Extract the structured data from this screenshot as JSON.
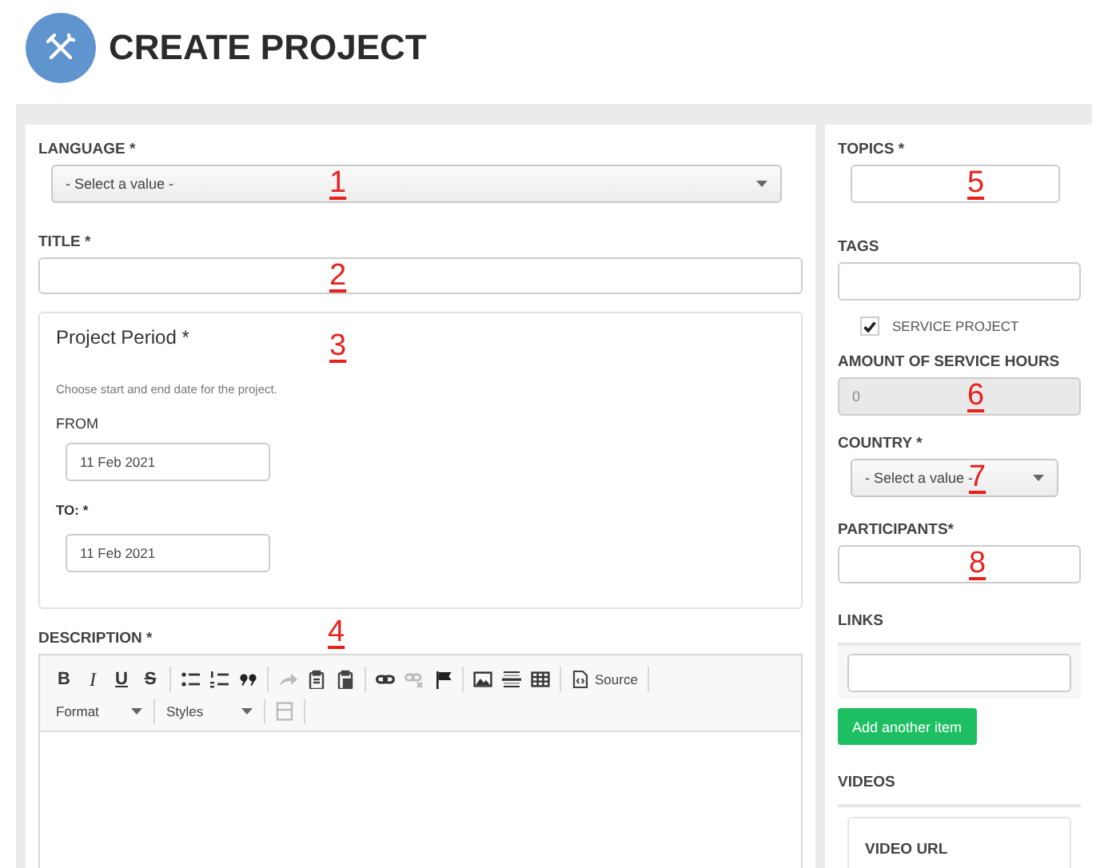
{
  "header": {
    "title": "CREATE PROJECT"
  },
  "main": {
    "language": {
      "label": "LANGUAGE *",
      "value": "- Select a value -",
      "annotation": "1"
    },
    "title": {
      "label": "TITLE *",
      "annotation": "2"
    },
    "period": {
      "heading": "Project Period *",
      "annotation": "3",
      "hint": "Choose start and end date for the project.",
      "from": {
        "label": "FROM",
        "value": "11 Feb 2021"
      },
      "to": {
        "label": "TO: *",
        "value": "11 Feb 2021"
      }
    },
    "description": {
      "label": "DESCRIPTION *",
      "annotation": "4",
      "toolbar": [
        [
          [
            {
              "kind": "bold",
              "label": "B",
              "disabled": false
            },
            {
              "kind": "italic",
              "label": "I",
              "disabled": false
            },
            {
              "kind": "underline",
              "label": "U",
              "disabled": false
            },
            {
              "kind": "strike",
              "label": "S",
              "disabled": false
            }
          ],
          [
            {
              "kind": "bullets",
              "disabled": false
            },
            {
              "kind": "numbers",
              "disabled": false
            },
            {
              "kind": "quote",
              "disabled": false
            }
          ],
          [
            {
              "kind": "redo",
              "disabled": true
            },
            {
              "kind": "paste",
              "disabled": false
            },
            {
              "kind": "pastetext",
              "disabled": false
            }
          ],
          [
            {
              "kind": "link",
              "disabled": false
            },
            {
              "kind": "unlink",
              "disabled": true
            },
            {
              "kind": "flag",
              "disabled": false
            }
          ],
          [
            {
              "kind": "image",
              "disabled": false
            },
            {
              "kind": "hrule",
              "disabled": false
            },
            {
              "kind": "table",
              "disabled": false
            }
          ],
          [
            {
              "kind": "source",
              "label": "Source",
              "disabled": false
            }
          ]
        ],
        [
          [
            {
              "kind": "dropdown",
              "label": "Format",
              "disabled": false
            }
          ],
          [
            {
              "kind": "dropdown",
              "label": "Styles",
              "disabled": false
            }
          ],
          [
            {
              "kind": "frame",
              "disabled": true
            }
          ]
        ]
      ]
    }
  },
  "sidebar": {
    "topics": {
      "label": "TOPICS *",
      "annotation": "5"
    },
    "tags": {
      "label": "TAGS"
    },
    "service_project": {
      "label": "SERVICE PROJECT",
      "checked": true
    },
    "service_hours": {
      "label": "AMOUNT OF SERVICE HOURS",
      "value": "0",
      "disabled": true,
      "annotation": "6"
    },
    "country": {
      "label": "COUNTRY *",
      "value": "- Select a value -",
      "annotation": "7"
    },
    "participants": {
      "label": "PARTICIPANTS*",
      "annotation": "8"
    },
    "links": {
      "label": "LINKS",
      "button": "Add another item"
    },
    "videos": {
      "label": "VIDEOS",
      "card_label": "VIDEO URL"
    }
  }
}
